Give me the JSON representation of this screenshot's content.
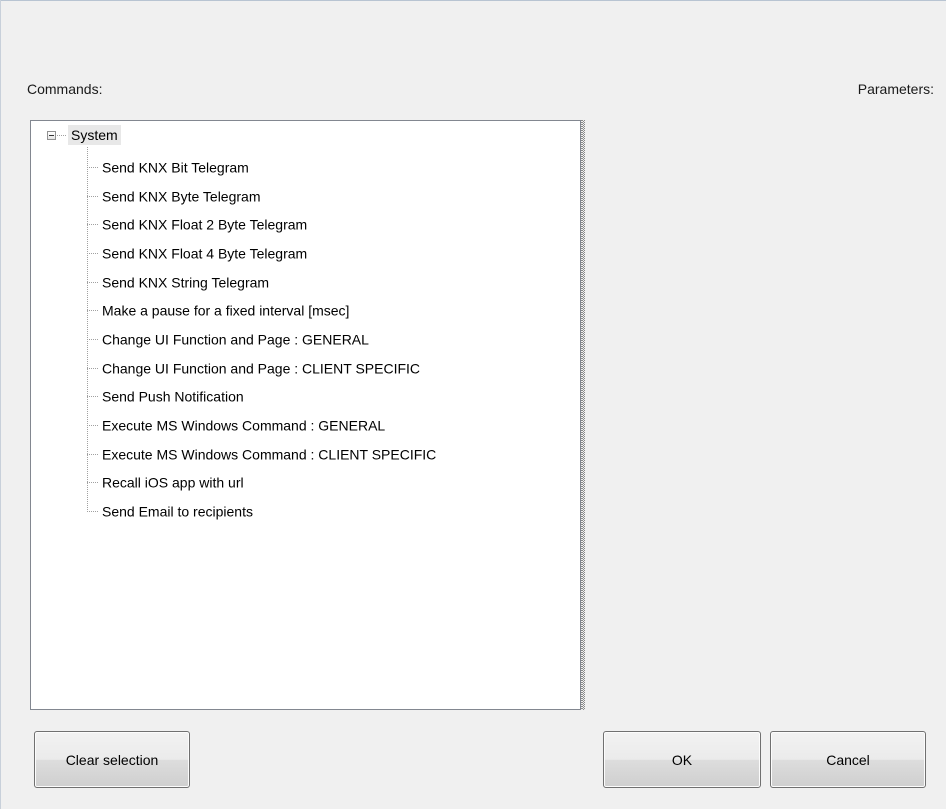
{
  "labels": {
    "commands": "Commands:",
    "parameters": "Parameters:"
  },
  "tree": {
    "root": "System",
    "items": [
      "Send KNX Bit Telegram",
      "Send KNX Byte Telegram",
      "Send KNX Float 2 Byte Telegram",
      "Send KNX Float 4 Byte Telegram",
      "Send KNX String Telegram",
      "Make a pause for a fixed interval [msec]",
      "Change UI Function and Page : GENERAL",
      "Change UI Function and Page : CLIENT SPECIFIC",
      "Send Push Notification",
      "Execute MS Windows Command : GENERAL",
      "Execute MS Windows Command : CLIENT SPECIFIC",
      "Recall iOS app with url",
      "Send Email to recipients"
    ]
  },
  "buttons": {
    "clear": "Clear  selection",
    "ok": "OK",
    "cancel": "Cancel"
  }
}
